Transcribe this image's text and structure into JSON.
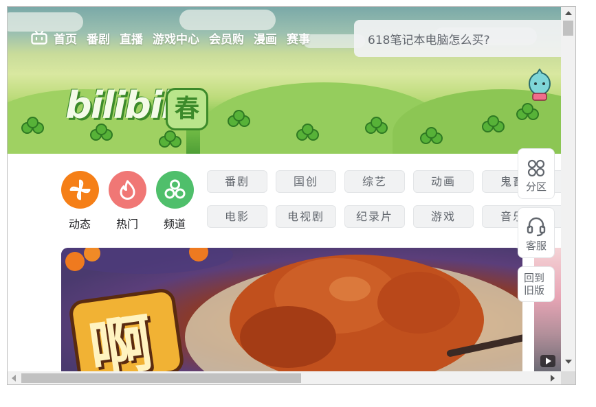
{
  "nav": {
    "items": [
      "首页",
      "番剧",
      "直播",
      "游戏中心",
      "会员购",
      "漫画",
      "赛事"
    ]
  },
  "search": {
    "placeholder": "618笔记本电脑怎么买?"
  },
  "banner": {
    "logo_text": "bilibili",
    "logo_mark": "春"
  },
  "quick": {
    "items": [
      {
        "label": "动态",
        "icon": "pinwheel-icon",
        "color": "#f57f17"
      },
      {
        "label": "热门",
        "icon": "flame-icon",
        "color": "#f07775"
      },
      {
        "label": "频道",
        "icon": "channels-icon",
        "color": "#4fbf6b"
      }
    ]
  },
  "channels": {
    "row1": [
      "番剧",
      "国创",
      "综艺",
      "动画",
      "鬼畜"
    ],
    "row2": [
      "电影",
      "电视剧",
      "纪录片",
      "游戏",
      "音乐"
    ]
  },
  "side": {
    "zones_label": "分区",
    "service_label": "客服",
    "old_version_label": "回到旧版"
  },
  "carousel": {
    "title_art": "啊"
  },
  "colors": {
    "brand_pink": "#fb7299",
    "text_gray": "#61666d",
    "tag_bg": "#f1f2f3"
  }
}
